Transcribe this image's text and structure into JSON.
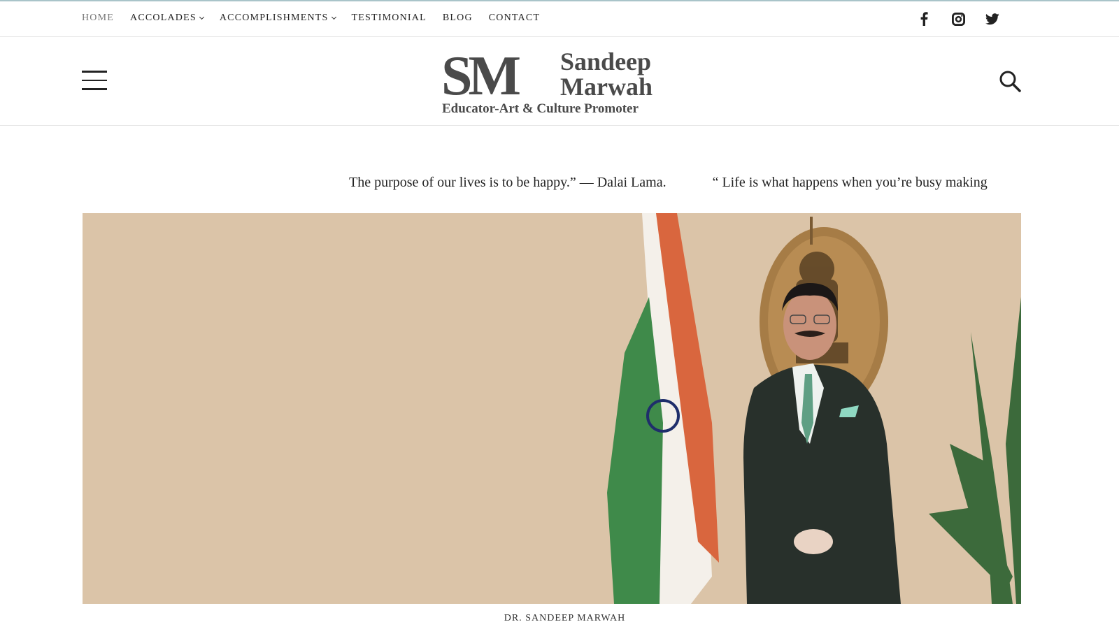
{
  "nav": {
    "items": [
      {
        "label": "HOME",
        "active": true,
        "has_dropdown": false
      },
      {
        "label": "ACCOLADES",
        "active": false,
        "has_dropdown": true
      },
      {
        "label": "ACCOMPLISHMENTS",
        "active": false,
        "has_dropdown": true
      },
      {
        "label": "TESTIMONIAL",
        "active": false,
        "has_dropdown": false
      },
      {
        "label": "BLOG",
        "active": false,
        "has_dropdown": false
      },
      {
        "label": "CONTACT",
        "active": false,
        "has_dropdown": false
      }
    ],
    "socials": [
      "facebook-icon",
      "instagram-icon",
      "twitter-icon"
    ]
  },
  "header": {
    "logo_initials": "SM",
    "logo_name_line1": "Sandeep",
    "logo_name_line2": "Marwah",
    "logo_tagline": "Educator-Art & Culture Promoter",
    "menu_icon": "hamburger-icon",
    "search_icon": "search-icon"
  },
  "ticker": {
    "quotes": [
      "The purpose of our lives is to be happy.” — Dalai Lama.",
      "“ Life is what happens when you’re busy making"
    ]
  },
  "hero": {
    "caption": "DR. SANDEEP MARWAH"
  },
  "colors": {
    "accent_line": "#a9c4c9",
    "hero_bg": "#dbc4a8",
    "logo_gray": "#4a4a4a",
    "flag_saffron": "#d9663e",
    "flag_green": "#3f8a4a"
  }
}
